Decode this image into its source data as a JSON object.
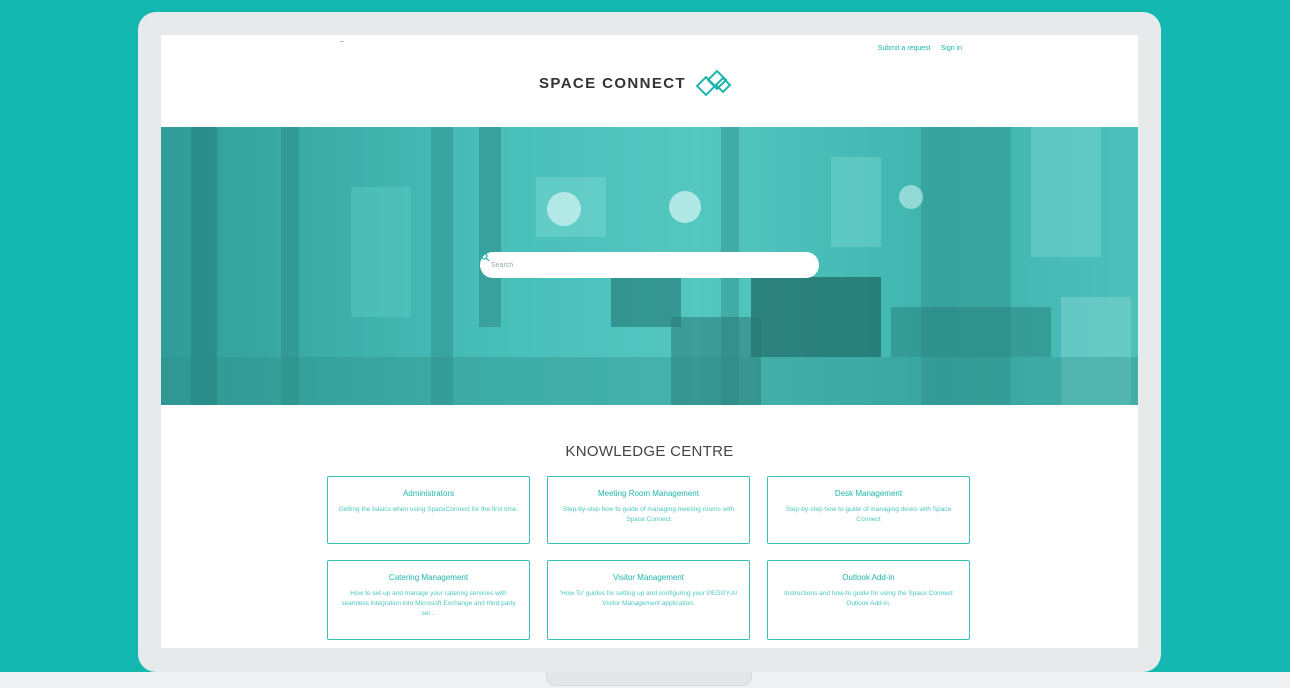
{
  "header": {
    "links": {
      "submit_request": "Submit a request",
      "sign_in": "Sign in"
    },
    "brand": "SPACE CONNECT"
  },
  "search": {
    "placeholder": "Search"
  },
  "knowledge": {
    "title": "KNOWLEDGE CENTRE",
    "cards": [
      {
        "title": "Administrators",
        "description": "Getting the basics when using SpaceConnect for the first time."
      },
      {
        "title": "Meeting Room Management",
        "description": "Step-by-step how to guide of managing meeting rooms with Space Connect"
      },
      {
        "title": "Desk Management",
        "description": "Step-by-step how to guide of managing desks with Space Connect"
      },
      {
        "title": "Catering Management",
        "description": "How to set-up and manage your catering services with seamless integration into Microsoft Exchange and third party ser..."
      },
      {
        "title": "Visitor Management",
        "description": "'How To' guides for setting up and configuring your PEGGY.AI Visitor Management application."
      },
      {
        "title": "Outlook Add-in",
        "description": "Instructions and how-to guide for using the Space Connect Outlook Add-in."
      }
    ]
  },
  "colors": {
    "background": "#14b8b1",
    "accent": "#1fb5ad",
    "hero_tint": "#4fc4be"
  }
}
